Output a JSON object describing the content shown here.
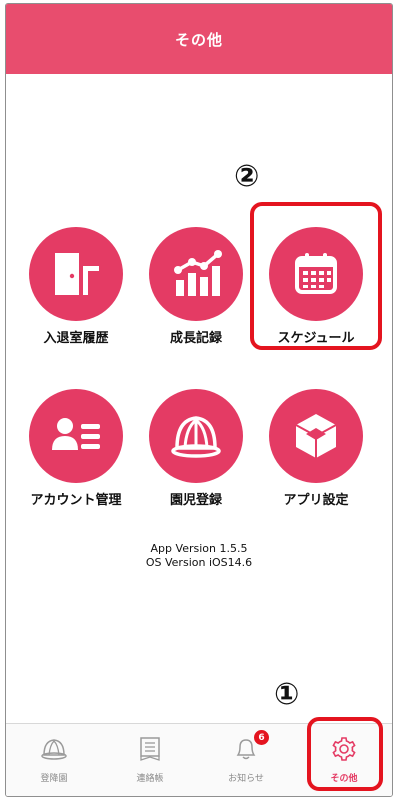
{
  "header": {
    "title": "その他"
  },
  "annotations": {
    "step2": "②",
    "step1": "①"
  },
  "menu": {
    "items": [
      {
        "label": "入退室履歴",
        "icon": "door-icon"
      },
      {
        "label": "成長記録",
        "icon": "growth-chart-icon"
      },
      {
        "label": "スケジュール",
        "icon": "calendar-icon"
      },
      {
        "label": "アカウント管理",
        "icon": "account-card-icon"
      },
      {
        "label": "園児登録",
        "icon": "kindergarten-hat-icon"
      },
      {
        "label": "アプリ設定",
        "icon": "cube-icon"
      }
    ]
  },
  "version": {
    "app": "App Version 1.5.5",
    "os": "OS Version iOS14.6"
  },
  "tabbar": {
    "tabs": [
      {
        "label": "登降園",
        "icon": "hat-icon"
      },
      {
        "label": "連絡帳",
        "icon": "notebook-icon"
      },
      {
        "label": "お知らせ",
        "icon": "bell-icon",
        "badge": "6"
      },
      {
        "label": "その他",
        "icon": "gear-icon"
      }
    ]
  },
  "colors": {
    "accent": "#e43b64",
    "header": "#e84d6e",
    "highlight": "#e4141f"
  }
}
